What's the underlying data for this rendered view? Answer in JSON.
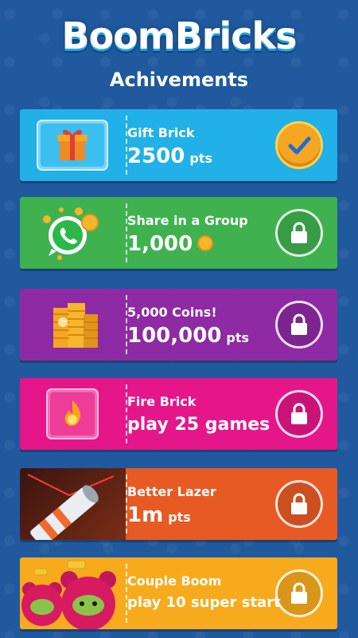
{
  "app": {
    "logo": "BoomBricks",
    "subtitle": "Achivements"
  },
  "achievements": [
    {
      "title": "Gift Brick",
      "value": "2500",
      "unit": "pts",
      "status": "completed",
      "color": "#21b0e8",
      "icon": "gift-icon"
    },
    {
      "title": "Share in a Group",
      "value": "1,000",
      "unit": "coin",
      "status": "locked",
      "color": "#3fb24f",
      "icon": "whatsapp-icon"
    },
    {
      "title": "5,000 Coins!",
      "value": "100,000",
      "unit": "pts",
      "status": "locked",
      "color": "#8e2aa3",
      "icon": "coin-stack-icon"
    },
    {
      "title": "Fire Brick",
      "value": "play 25 games",
      "unit": "",
      "status": "locked",
      "color": "#e5168a",
      "icon": "fire-brick-icon"
    },
    {
      "title": "Better Lazer",
      "value": "1m",
      "unit": "pts",
      "status": "locked",
      "color": "#e85a24",
      "icon": "lazer-cannon-icon"
    },
    {
      "title": "Couple Boom",
      "value": "play 10 super start",
      "unit": "",
      "status": "locked",
      "color": "#f7ab1c",
      "icon": "bear-characters-icon"
    }
  ]
}
